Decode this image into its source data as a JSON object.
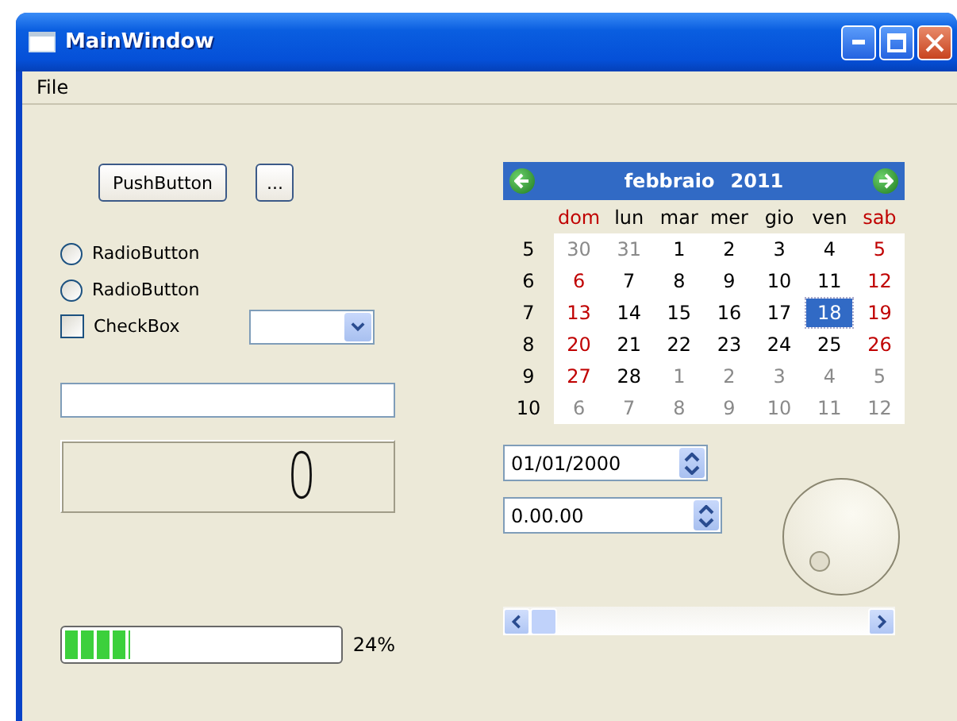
{
  "window": {
    "title": "MainWindow"
  },
  "menu": [
    "File"
  ],
  "buttons": [
    {
      "label": "PushButton"
    },
    {
      "label": "..."
    }
  ],
  "radios": [
    {
      "label": "RadioButton",
      "selected": false
    },
    {
      "label": "RadioButton",
      "selected": false
    }
  ],
  "checkbox": {
    "label": "CheckBox",
    "checked": false
  },
  "lcd": {
    "value": "0"
  },
  "progress": {
    "level": 0.24,
    "reading": "24%"
  },
  "calendar": {
    "month": "febbraio",
    "year": "2011",
    "day_names": [
      {
        "label": "dom",
        "weekend": true
      },
      {
        "label": "lun",
        "weekend": false
      },
      {
        "label": "mar",
        "weekend": false
      },
      {
        "label": "mer",
        "weekend": false
      },
      {
        "label": "gio",
        "weekend": false
      },
      {
        "label": "ven",
        "weekend": false
      },
      {
        "label": "sab",
        "weekend": true
      }
    ],
    "weeks": [
      {
        "number": "5",
        "days": [
          {
            "day": "30",
            "outside": true,
            "selected": false
          },
          {
            "day": "31",
            "outside": true,
            "selected": false
          },
          {
            "day": "1",
            "outside": false,
            "selected": false
          },
          {
            "day": "2",
            "outside": false,
            "selected": false
          },
          {
            "day": "3",
            "outside": false,
            "selected": false
          },
          {
            "day": "4",
            "outside": false,
            "selected": false
          },
          {
            "day": "5",
            "outside": false,
            "selected": false
          }
        ]
      },
      {
        "number": "6",
        "days": [
          {
            "day": "6",
            "outside": false,
            "selected": false
          },
          {
            "day": "7",
            "outside": false,
            "selected": false
          },
          {
            "day": "8",
            "outside": false,
            "selected": false
          },
          {
            "day": "9",
            "outside": false,
            "selected": false
          },
          {
            "day": "10",
            "outside": false,
            "selected": false
          },
          {
            "day": "11",
            "outside": false,
            "selected": false
          },
          {
            "day": "12",
            "outside": false,
            "selected": false
          }
        ]
      },
      {
        "number": "7",
        "days": [
          {
            "day": "13",
            "outside": false,
            "selected": false
          },
          {
            "day": "14",
            "outside": false,
            "selected": false
          },
          {
            "day": "15",
            "outside": false,
            "selected": false
          },
          {
            "day": "16",
            "outside": false,
            "selected": false
          },
          {
            "day": "17",
            "outside": false,
            "selected": false
          },
          {
            "day": "18",
            "outside": false,
            "selected": true
          },
          {
            "day": "19",
            "outside": false,
            "selected": false
          }
        ]
      },
      {
        "number": "8",
        "days": [
          {
            "day": "20",
            "outside": false,
            "selected": false
          },
          {
            "day": "21",
            "outside": false,
            "selected": false
          },
          {
            "day": "22",
            "outside": false,
            "selected": false
          },
          {
            "day": "23",
            "outside": false,
            "selected": false
          },
          {
            "day": "24",
            "outside": false,
            "selected": false
          },
          {
            "day": "25",
            "outside": false,
            "selected": false
          },
          {
            "day": "26",
            "outside": false,
            "selected": false
          }
        ]
      },
      {
        "number": "9",
        "days": [
          {
            "day": "27",
            "outside": false,
            "selected": false
          },
          {
            "day": "28",
            "outside": false,
            "selected": false
          },
          {
            "day": "1",
            "outside": true,
            "selected": false
          },
          {
            "day": "2",
            "outside": true,
            "selected": false
          },
          {
            "day": "3",
            "outside": true,
            "selected": false
          },
          {
            "day": "4",
            "outside": true,
            "selected": false
          },
          {
            "day": "5",
            "outside": true,
            "selected": false
          }
        ]
      },
      {
        "number": "10",
        "days": [
          {
            "day": "6",
            "outside": true,
            "selected": false
          },
          {
            "day": "7",
            "outside": true,
            "selected": false
          },
          {
            "day": "8",
            "outside": true,
            "selected": false
          },
          {
            "day": "9",
            "outside": true,
            "selected": false
          },
          {
            "day": "10",
            "outside": true,
            "selected": false
          },
          {
            "day": "11",
            "outside": true,
            "selected": false
          },
          {
            "day": "12",
            "outside": true,
            "selected": false
          }
        ]
      }
    ]
  },
  "date_edit": {
    "value": "01/01/2000"
  },
  "time_edit": {
    "value": "0.00.00"
  }
}
